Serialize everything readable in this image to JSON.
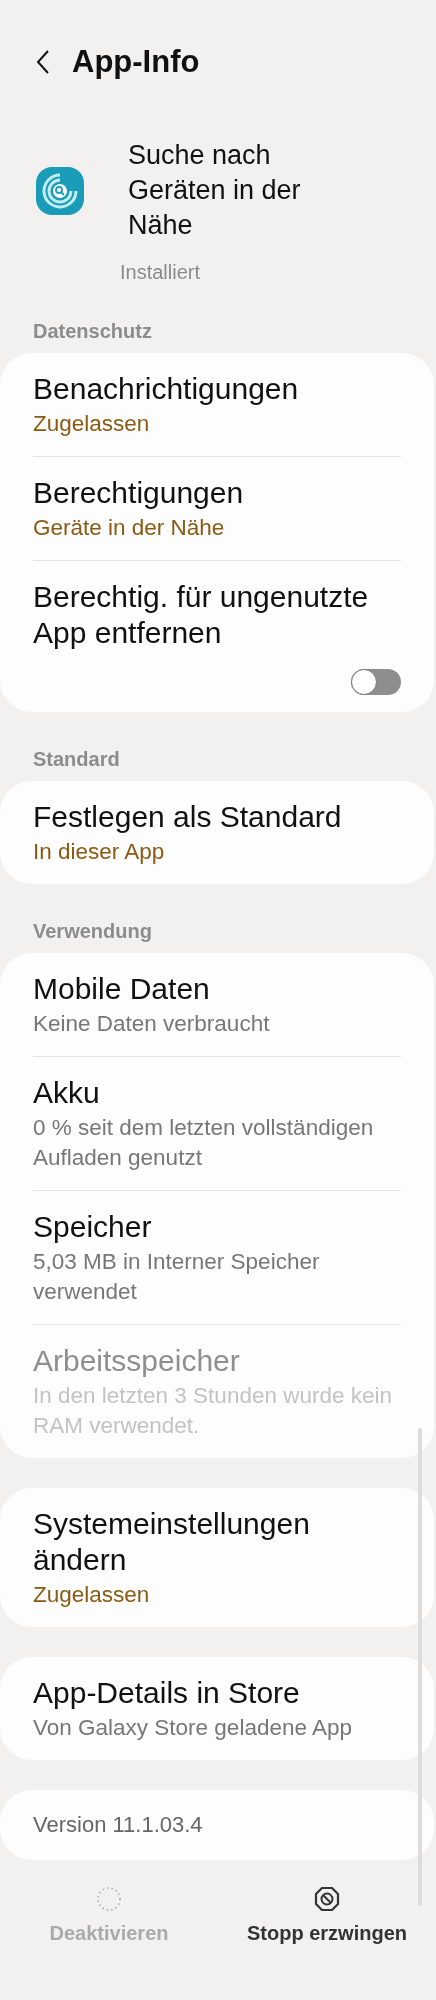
{
  "header": {
    "title": "App-Info"
  },
  "app": {
    "name": "Suche nach Geräten in der Nähe",
    "status": "Installiert"
  },
  "sections": [
    {
      "heading": "Datenschutz",
      "items": [
        {
          "kind": "row",
          "title": "Benachrichtigungen",
          "summary": "Zugelassen",
          "accent": true,
          "disabled": false
        },
        {
          "kind": "row",
          "title": "Berechtigungen",
          "summary": "Geräte in der Nähe",
          "accent": true,
          "disabled": false
        },
        {
          "kind": "toggle",
          "title": "Berechtig. für ungenutzte App entfernen",
          "on": false,
          "disabled": false
        }
      ]
    },
    {
      "heading": "Standard",
      "items": [
        {
          "kind": "row",
          "title": "Festlegen als Standard",
          "summary": "In dieser App",
          "accent": true,
          "disabled": false
        }
      ]
    },
    {
      "heading": "Verwendung",
      "items": [
        {
          "kind": "row",
          "title": "Mobile Daten",
          "summary": "Keine Daten verbraucht",
          "accent": false,
          "disabled": false
        },
        {
          "kind": "row",
          "title": "Akku",
          "summary": "0 % seit dem letzten vollständigen Aufladen genutzt",
          "accent": false,
          "disabled": false
        },
        {
          "kind": "row",
          "title": "Speicher",
          "summary": "5,03 MB in Interner Speicher verwendet",
          "accent": false,
          "disabled": false
        },
        {
          "kind": "row",
          "title": "Arbeitsspeicher",
          "summary": "In den letzten 3 Stunden wurde kein RAM verwendet.",
          "accent": false,
          "disabled": true
        }
      ]
    },
    {
      "items": [
        {
          "kind": "row",
          "title": "Systemeinstellungen ändern",
          "summary": "Zugelassen",
          "accent": true,
          "disabled": false
        }
      ]
    },
    {
      "items": [
        {
          "kind": "row",
          "title": "App-Details in Store",
          "summary": "Von Galaxy Store geladene App",
          "accent": false,
          "disabled": false
        }
      ]
    },
    {
      "items": [
        {
          "kind": "version",
          "title": "Version 11.1.03.4"
        }
      ]
    }
  ],
  "bottom_bar": [
    {
      "kind": "disable",
      "label": "Deaktivieren",
      "disabled": true
    },
    {
      "kind": "force_stop",
      "label": "Stopp erzwingen",
      "disabled": false
    }
  ]
}
